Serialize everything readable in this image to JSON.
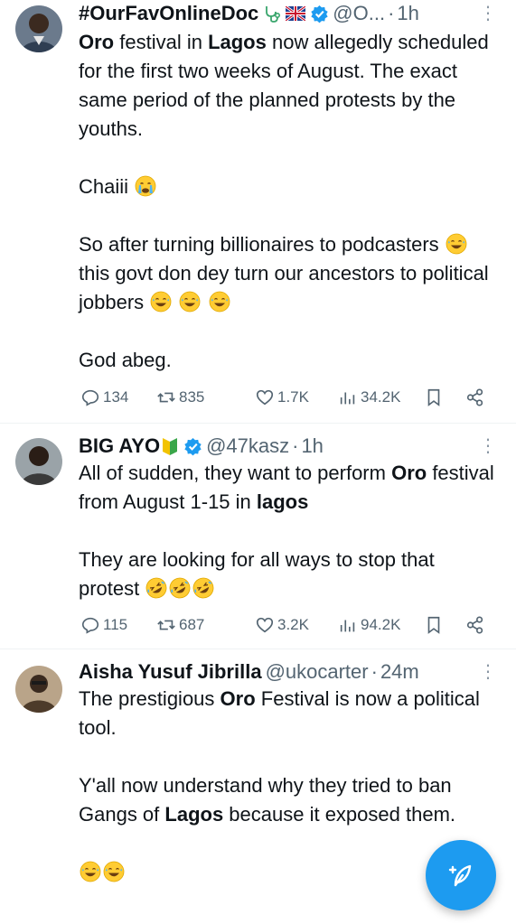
{
  "tweets": [
    {
      "name": "#OurFavOnlineDoc",
      "badges": [
        "stethoscope-icon",
        "uk-flag-icon"
      ],
      "verified": true,
      "handle": "@O...",
      "time": "1h",
      "paragraphs": [
        [
          {
            "t": "Oro",
            "b": true
          },
          {
            "t": " festival in "
          },
          {
            "t": "Lagos",
            "b": true
          },
          {
            "t": " now allegedly scheduled for the first two weeks of August. The exact same period of the planned protests by the youths."
          }
        ],
        [
          {
            "t": "Chaiii "
          },
          {
            "e": "crying"
          }
        ],
        [
          {
            "t": "So after turning billionaires to podcasters "
          },
          {
            "e": "laughing"
          },
          {
            "t": " this govt don dey turn our ancestors to political jobbers "
          },
          {
            "e": "laughing"
          },
          {
            "t": " "
          },
          {
            "e": "laughing"
          },
          {
            "t": " "
          },
          {
            "e": "laughing"
          }
        ],
        [
          {
            "t": "God abeg."
          }
        ]
      ],
      "stats": {
        "replies": "134",
        "reposts": "835",
        "likes": "1.7K",
        "views": "34.2K"
      }
    },
    {
      "name": "BIG AYO",
      "badges": [
        "beginner-badge-icon"
      ],
      "verified": true,
      "handle": "@47kasz",
      "time": "1h",
      "paragraphs": [
        [
          {
            "t": "All of sudden, they want to perform "
          },
          {
            "t": "Oro",
            "b": true
          },
          {
            "t": " festival from August 1-15 in "
          },
          {
            "t": "lagos",
            "b": true
          }
        ],
        [
          {
            "t": "They are looking for all ways to stop that protest "
          },
          {
            "e": "rofl"
          },
          {
            "e": "rofl"
          },
          {
            "e": "rofl"
          }
        ]
      ],
      "stats": {
        "replies": "115",
        "reposts": "687",
        "likes": "3.2K",
        "views": "94.2K"
      }
    },
    {
      "name": "Aisha Yusuf Jibrilla",
      "badges": [],
      "verified": false,
      "handle": "@ukocarter",
      "time": "24m",
      "paragraphs": [
        [
          {
            "t": "The prestigious "
          },
          {
            "t": "Oro",
            "b": true
          },
          {
            "t": " Festival is now a political tool."
          }
        ],
        [
          {
            "t": "Y'all now understand why they tried to ban Gangs of "
          },
          {
            "t": "Lagos",
            "b": true
          },
          {
            "t": " because it exposed them."
          }
        ],
        [
          {
            "e": "laughing"
          },
          {
            "e": "laughing"
          }
        ]
      ],
      "stats": null
    }
  ],
  "fab": {
    "icon": "compose-icon"
  },
  "colors": {
    "accent": "#1d9bf0",
    "text": "#0f1419",
    "secondary": "#536471",
    "divider": "#eff3f4"
  }
}
